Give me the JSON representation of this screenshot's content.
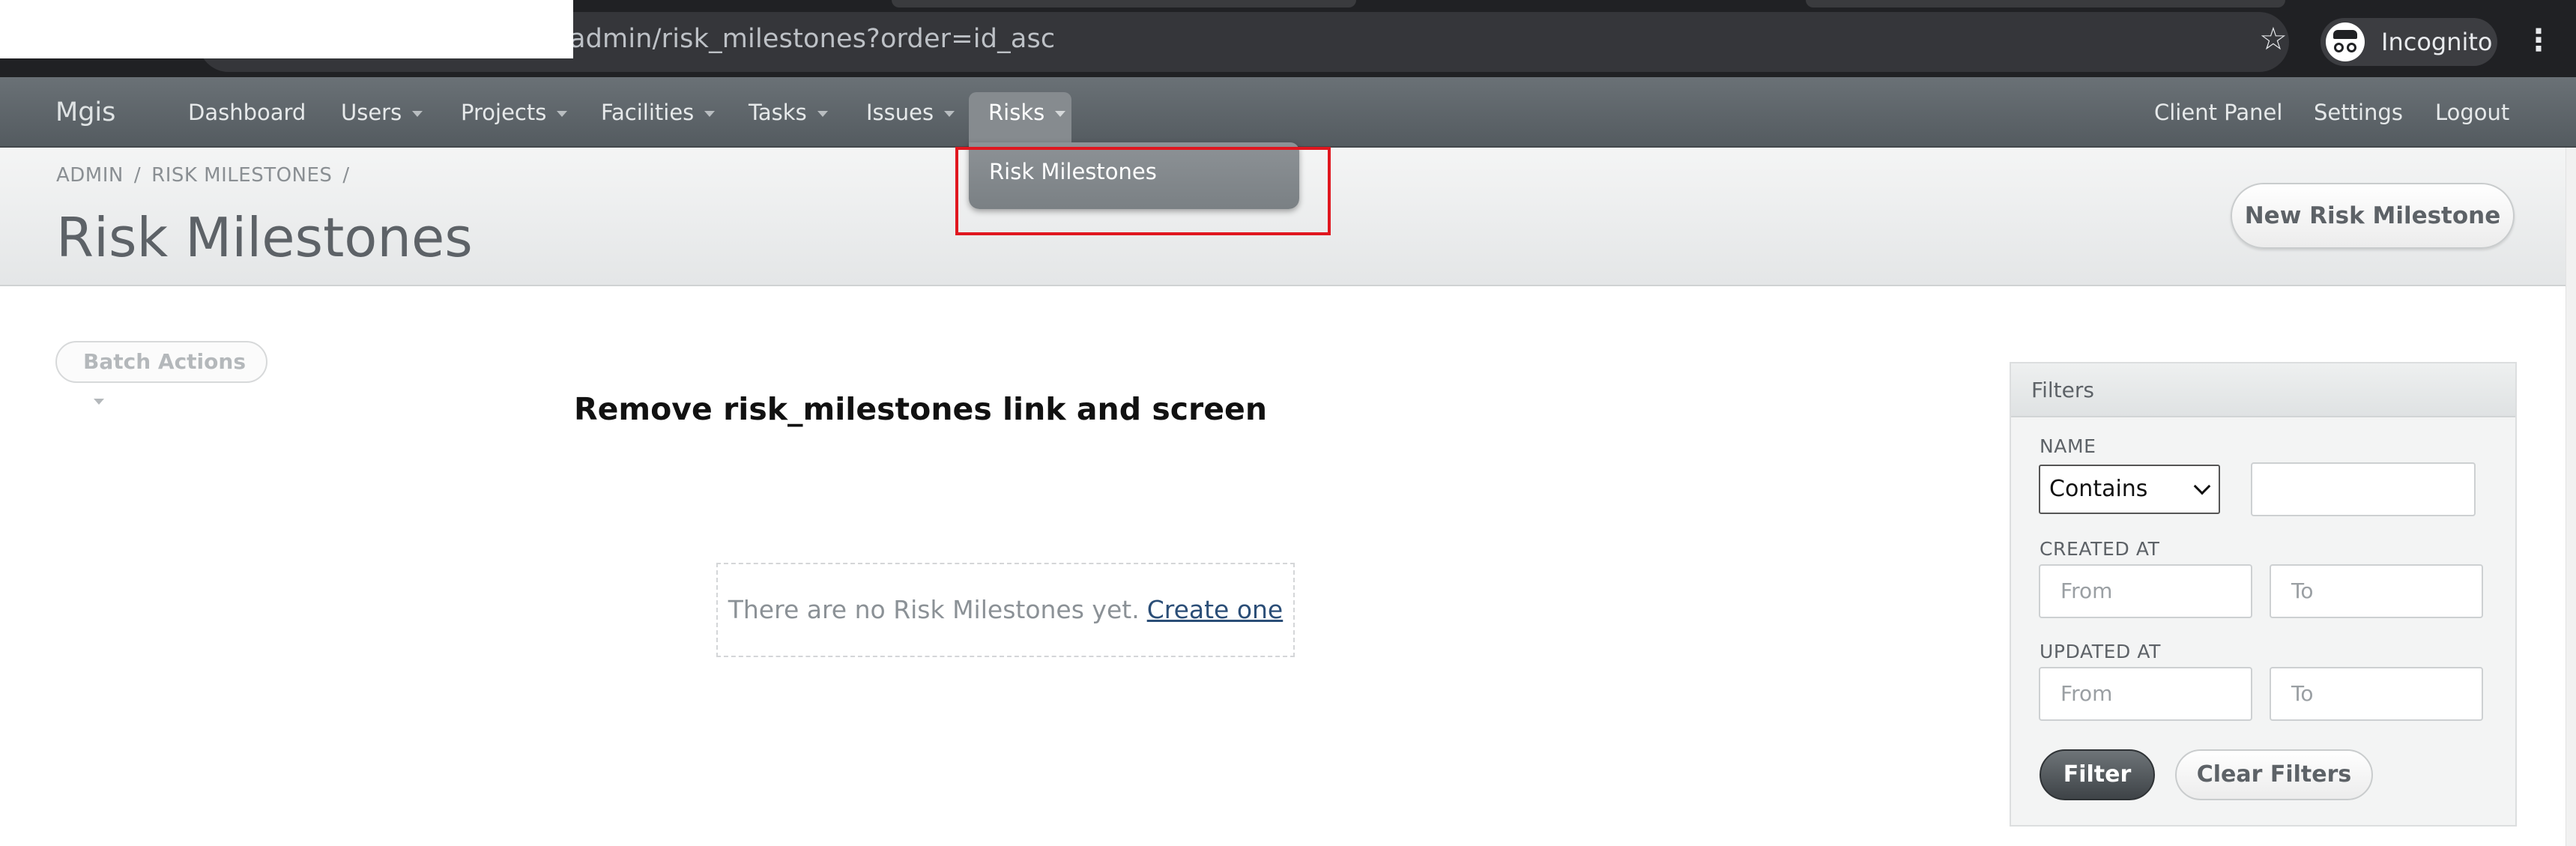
{
  "browser": {
    "url": "/admin/risk_milestones?order=id_asc",
    "incognito_label": "Incognito",
    "star_icon": "star-icon",
    "menu_icon": "kebab-menu-icon"
  },
  "header": {
    "brand": "Mgis",
    "nav": [
      {
        "label": "Dashboard"
      },
      {
        "label": "Users"
      },
      {
        "label": "Projects"
      },
      {
        "label": "Facilities"
      },
      {
        "label": "Tasks"
      },
      {
        "label": "Issues"
      },
      {
        "label": "Risks"
      }
    ],
    "right": [
      {
        "label": "Client Panel"
      },
      {
        "label": "Settings"
      },
      {
        "label": "Logout"
      }
    ],
    "dropdown": {
      "item": "Risk Milestones"
    }
  },
  "titlebar": {
    "crumbs": [
      "ADMIN",
      "RISK MILESTONES"
    ],
    "separator": "/",
    "title": "Risk Milestones",
    "new_button": "New Risk Milestone"
  },
  "main": {
    "batch_actions": "Batch Actions",
    "annotation": "Remove risk_milestones link and screen",
    "blank_text": "There are no Risk Milestones yet.",
    "create_link": "Create one"
  },
  "filters": {
    "title": "Filters",
    "name_label": "NAME",
    "name_operator": "Contains",
    "created_label": "CREATED AT",
    "updated_label": "UPDATED AT",
    "from_placeholder": "From",
    "to_placeholder": "To",
    "filter_button": "Filter",
    "clear_button": "Clear Filters"
  },
  "colors": {
    "header": "#5f666b",
    "highlight": "#e0171f",
    "link": "#2b4e77"
  }
}
